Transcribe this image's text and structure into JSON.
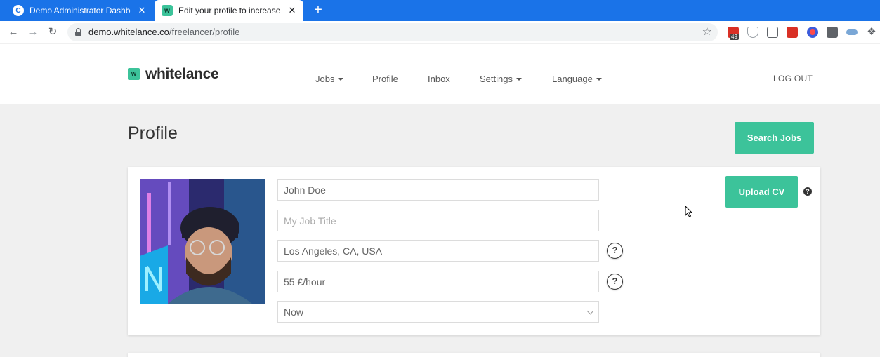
{
  "browser": {
    "tabs": [
      {
        "title": "Demo Administrator Dashboard",
        "favicon": "C",
        "close": "✕"
      },
      {
        "title": "Edit your profile to increase your",
        "favicon": "w",
        "close": "✕"
      }
    ],
    "new_tab": "+",
    "url_host": "demo.whitelance.co",
    "url_path": "/freelancer/profile",
    "extension_badge": "49"
  },
  "site": {
    "logo_mark": "w",
    "logo_text": "whitelance",
    "nav": [
      {
        "label": "Jobs",
        "dropdown": true
      },
      {
        "label": "Profile",
        "dropdown": false
      },
      {
        "label": "Inbox",
        "dropdown": false
      },
      {
        "label": "Settings",
        "dropdown": true
      },
      {
        "label": "Language",
        "dropdown": true
      }
    ],
    "logout": "LOG OUT"
  },
  "page": {
    "title": "Profile",
    "search_jobs": "Search Jobs",
    "upload_cv": "Upload CV",
    "help_glyph": "?",
    "fields": {
      "name": "John Doe",
      "job_title_placeholder": "My Job Title",
      "location": "Los Angeles, CA, USA",
      "rate": "55 £/hour",
      "availability": "Now"
    }
  },
  "colors": {
    "accent": "#3cc39a",
    "chrome_blue": "#1a73e8"
  }
}
